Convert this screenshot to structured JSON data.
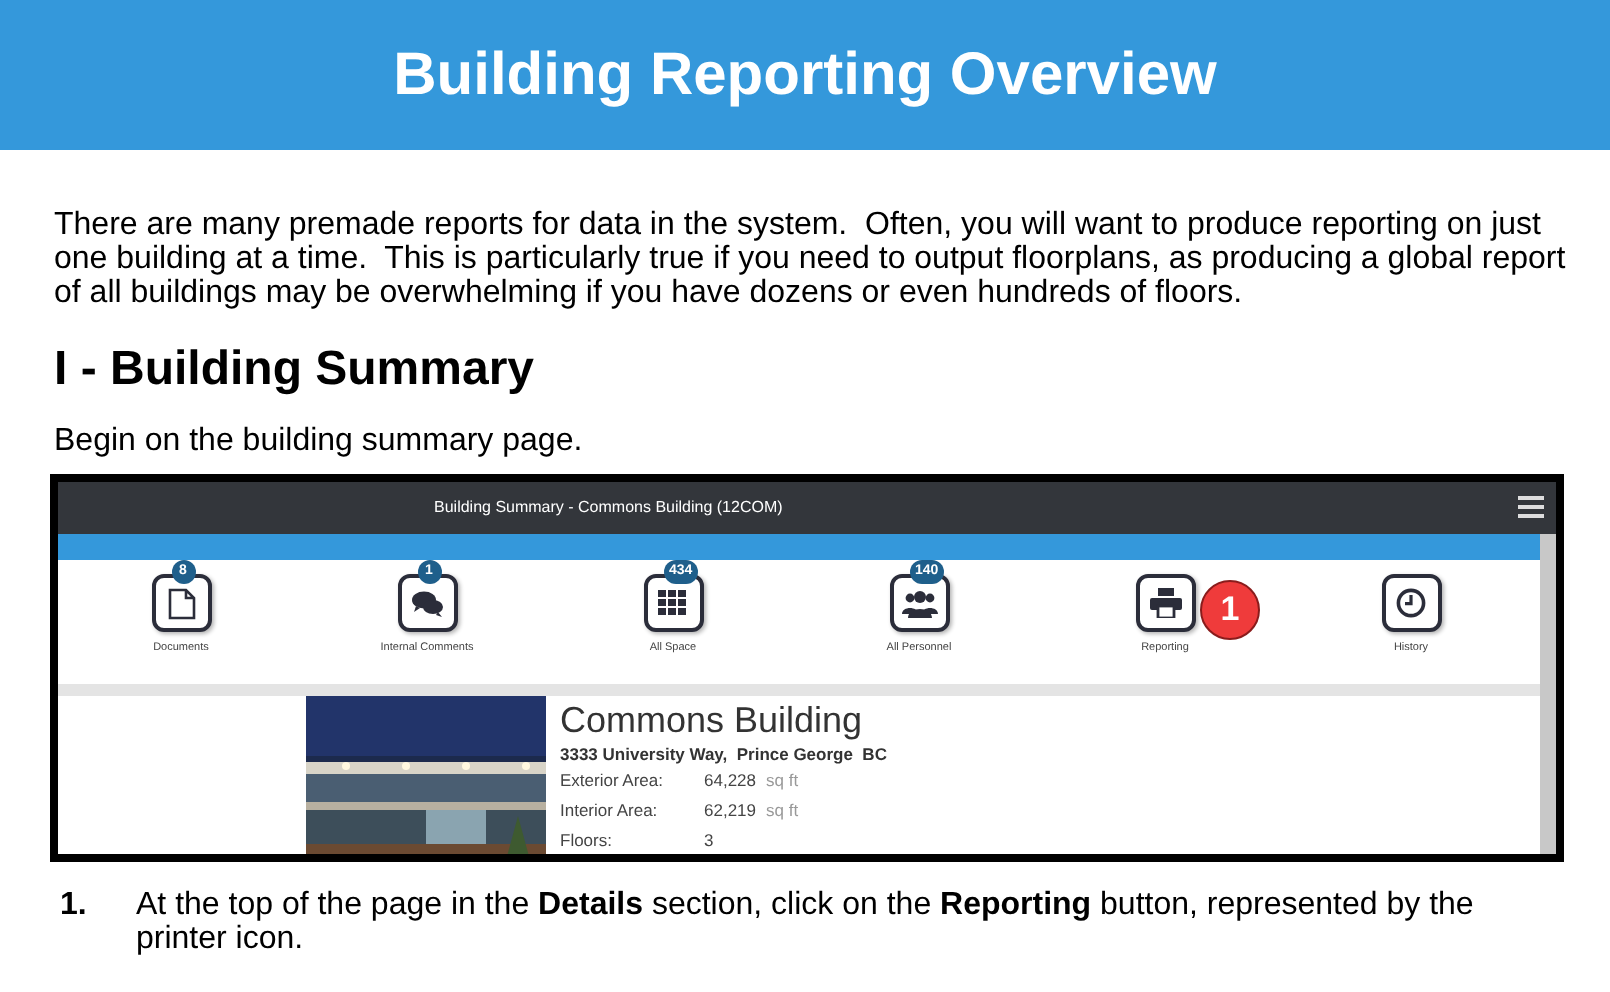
{
  "header": {
    "title": "Building Reporting Overview"
  },
  "intro": "There are many premade reports for data in the system.  Often, you will want to produce reporting on just one building at a time.  This is particularly true if you need to output floorplans, as producing a global report of all buildings may be overwhelming if you have dozens or even hundreds of floors.",
  "section": {
    "heading": "I - Building Summary",
    "text": "Begin on the building summary page."
  },
  "screenshot": {
    "title": "Building Summary - Commons Building (12COM)",
    "actions": [
      {
        "kind": "document",
        "label": "Documents",
        "badge": "8"
      },
      {
        "kind": "comments",
        "label": "Internal Comments",
        "badge": "1"
      },
      {
        "kind": "grid",
        "label": "All Space",
        "badge": "434"
      },
      {
        "kind": "people",
        "label": "All Personnel",
        "badge": "140"
      },
      {
        "kind": "printer",
        "label": "Reporting",
        "callout": "1"
      },
      {
        "kind": "clock",
        "label": "History"
      }
    ],
    "building": {
      "name": "Commons Building",
      "address": "3333 University Way,  Prince George  BC",
      "fields": [
        {
          "label": "Exterior Area:",
          "value": "64,228",
          "unit": "sq ft"
        },
        {
          "label": "Interior Area:",
          "value": "62,219",
          "unit": "sq ft"
        },
        {
          "label": "Floors:",
          "value": "3"
        }
      ]
    }
  },
  "steps": [
    {
      "number": "1.",
      "text": "At the top of the page in the **Details** section, click on the **Reporting** button, represented by the printer icon."
    }
  ]
}
